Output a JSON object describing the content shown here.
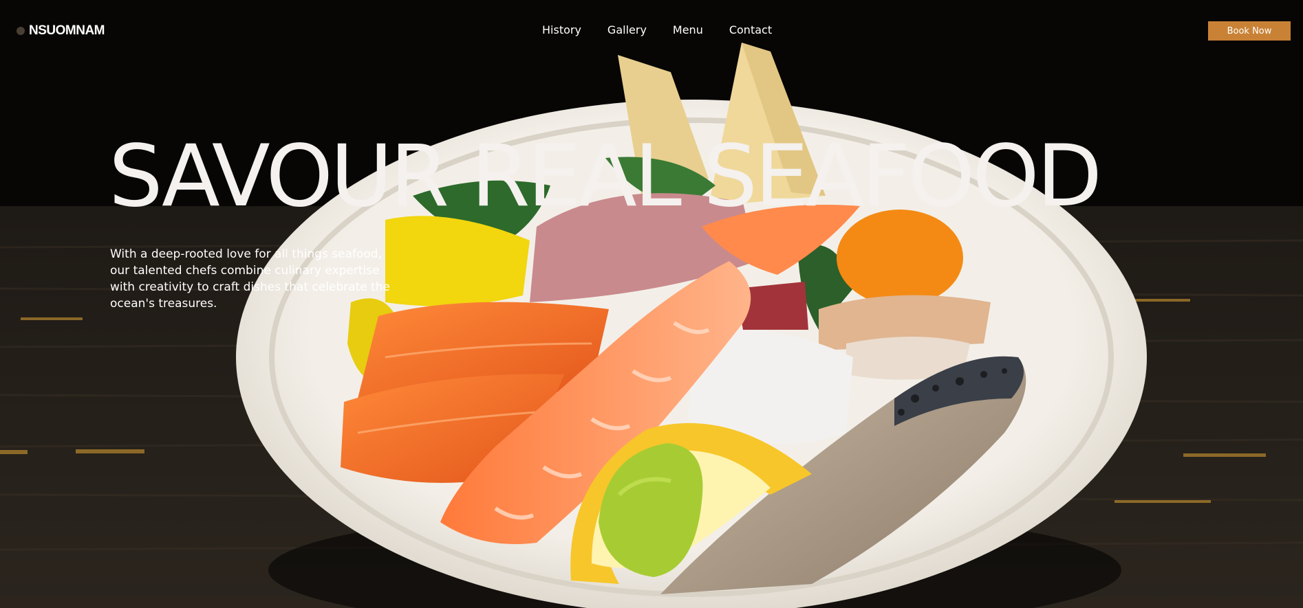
{
  "header": {
    "brand": "NSUOMNAM",
    "nav": [
      {
        "label": "History"
      },
      {
        "label": "Gallery"
      },
      {
        "label": "Menu"
      },
      {
        "label": "Contact"
      }
    ],
    "cta_label": "Book Now"
  },
  "hero": {
    "headline": "SAVOUR REAL SEAFOOD",
    "intro": "With a deep-rooted love for all things seafood, our talented chefs combine culinary expertise with creativity to craft dishes that celebrate the ocean's treasures."
  },
  "colors": {
    "accent": "#c98235",
    "background": "#0b0a09",
    "text": "#ffffff"
  }
}
